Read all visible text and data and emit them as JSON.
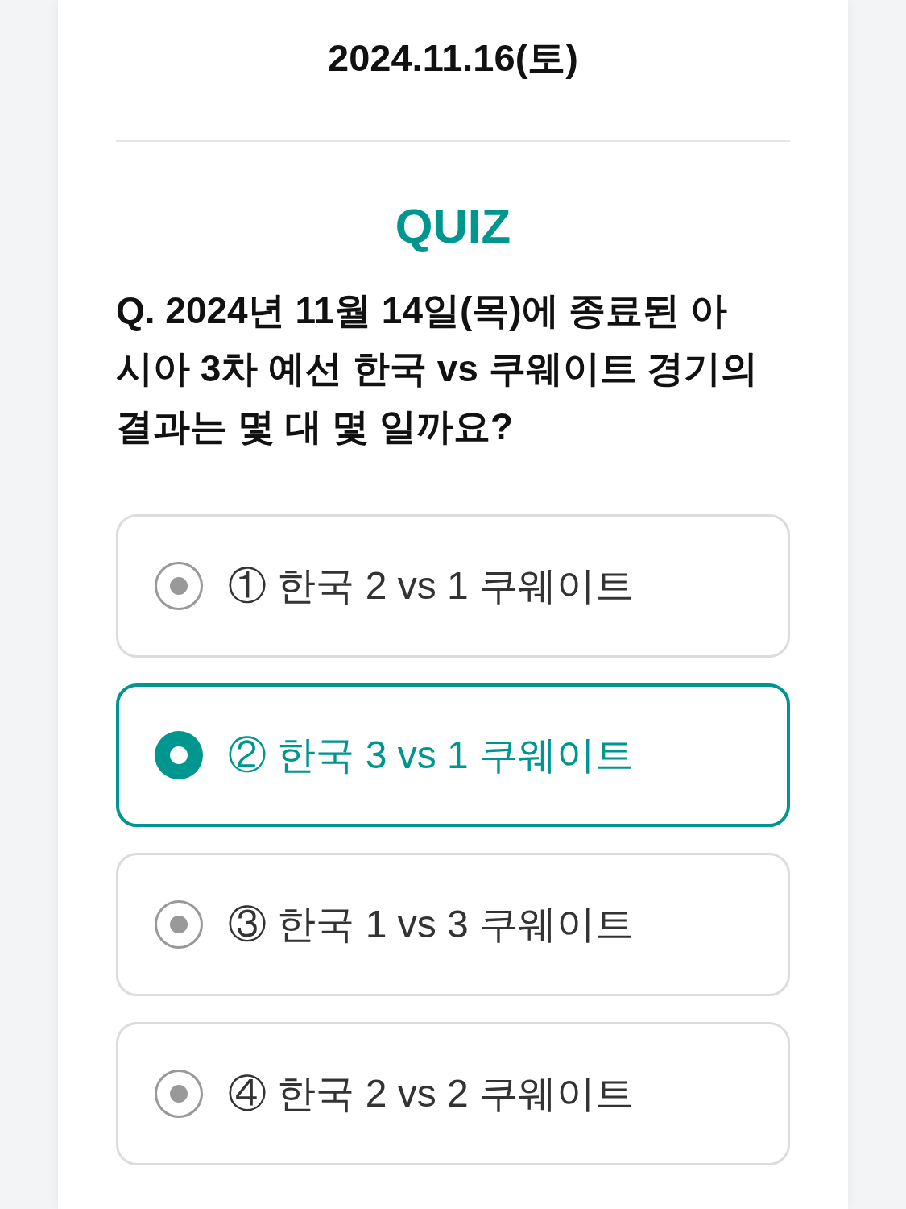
{
  "date": "2024.11.16(토)",
  "quiz": {
    "heading": "QUIZ",
    "question": "Q. 2024년 11월 14일(목)에 종료된 아시아 3차 예선 한국 vs 쿠웨이트 경기의 결과는 몇 대 몇 일까요?",
    "options": [
      {
        "label": "① 한국 2 vs 1 쿠웨이트",
        "selected": false
      },
      {
        "label": "② 한국 3 vs 1 쿠웨이트",
        "selected": true
      },
      {
        "label": "③ 한국 1 vs 3 쿠웨이트",
        "selected": false
      },
      {
        "label": "④ 한국 2 vs 2 쿠웨이트",
        "selected": false
      }
    ]
  }
}
